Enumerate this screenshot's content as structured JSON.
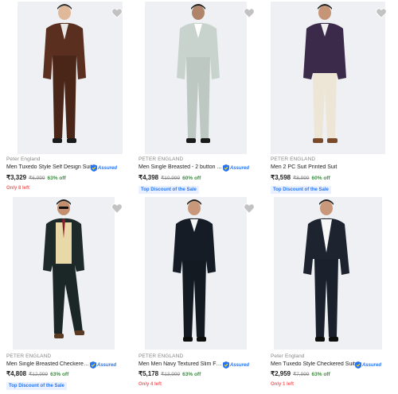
{
  "colors": {
    "accent": "#2874f0",
    "discount_green": "#388e3c",
    "stock_red": "#ff6161",
    "mrp_gray": "#878787"
  },
  "assured_label": "Assured",
  "products": [
    {
      "brand": "Peter England",
      "name": "Men Tuxedo Style Self Design Suit",
      "price": "₹3,329",
      "mrp": "₹6,999",
      "discount": "63% off",
      "tag": "Only 8 left",
      "tag_type": "stock"
    },
    {
      "brand": "PETER ENGLAND",
      "name": "Men Single Breasted - 2 button ...",
      "price": "₹4,398",
      "mrp": "₹10,999",
      "discount": "60% off",
      "tag": "Top Discount of the Sale",
      "tag_type": "discount"
    },
    {
      "brand": "PETER ENGLAND",
      "name": "Men 2 PC Suit Printed Suit",
      "price": "₹3,598",
      "mrp": "₹8,999",
      "discount": "60% off",
      "tag": "Top Discount of the Sale",
      "tag_type": "discount"
    },
    {
      "brand": "PETER ENGLAND",
      "name": "Men Single Breasted Checkered ...",
      "price": "₹4,808",
      "mrp": "₹12,999",
      "discount": "63% off",
      "tag": "Top Discount of the Sale",
      "tag_type": "discount"
    },
    {
      "brand": "PETER ENGLAND",
      "name": "Men Men Navy Textured Slim Fit...",
      "price": "₹5,178",
      "mrp": "₹13,999",
      "discount": "63% off",
      "tag": "Only 4 left",
      "tag_type": "stock"
    },
    {
      "brand": "Peter England",
      "name": "Men Tuxedo Style Checkered Suit",
      "price": "₹2,959",
      "mrp": "₹7,999",
      "discount": "63% off",
      "tag": "Only 1 left",
      "tag_type": "stock"
    }
  ]
}
